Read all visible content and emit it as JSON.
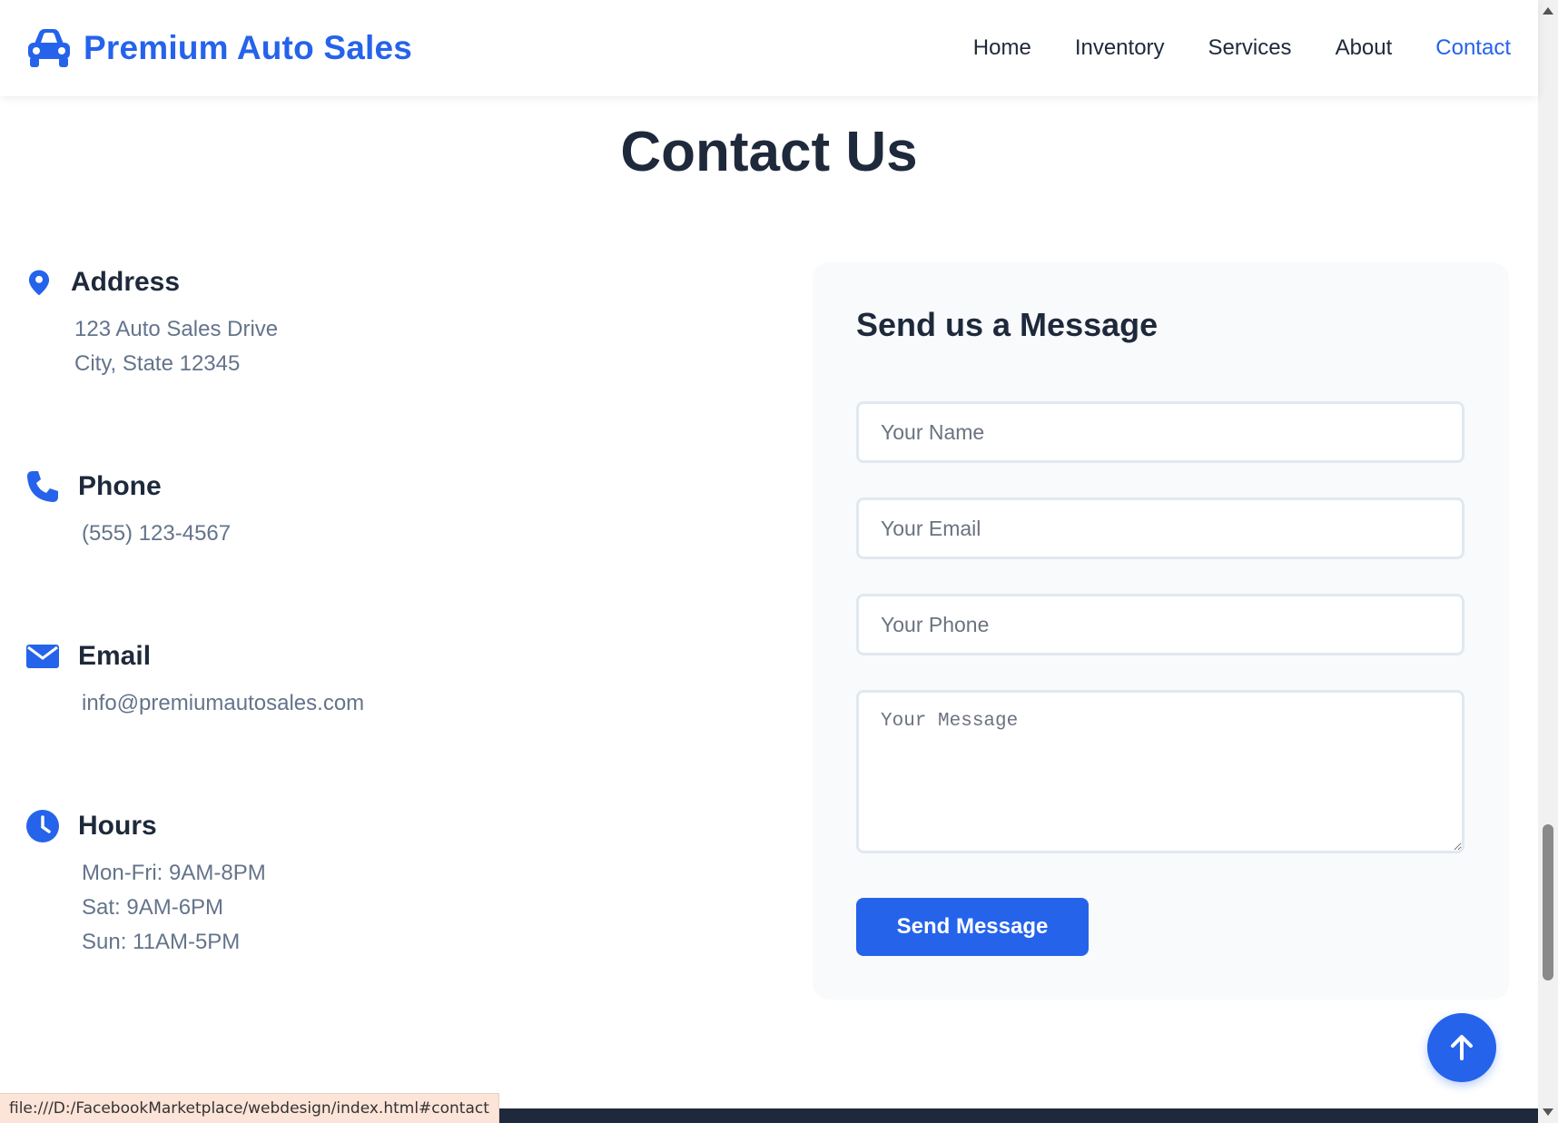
{
  "header": {
    "brand": "Premium Auto Sales",
    "brand_color": "#2563eb",
    "nav": [
      {
        "label": "Home",
        "active": false
      },
      {
        "label": "Inventory",
        "active": false
      },
      {
        "label": "Services",
        "active": false
      },
      {
        "label": "About",
        "active": false
      },
      {
        "label": "Contact",
        "active": true
      }
    ]
  },
  "page": {
    "title": "Contact Us"
  },
  "contact_info": {
    "address": {
      "title": "Address",
      "icon": "map-marker-icon",
      "lines": [
        "123 Auto Sales Drive",
        "City, State 12345"
      ]
    },
    "phone": {
      "title": "Phone",
      "icon": "phone-icon",
      "lines": [
        "(555) 123-4567"
      ]
    },
    "email": {
      "title": "Email",
      "icon": "envelope-icon",
      "lines": [
        "info@premiumautosales.com"
      ]
    },
    "hours": {
      "title": "Hours",
      "icon": "clock-icon",
      "lines": [
        "Mon-Fri: 9AM-8PM",
        "Sat: 9AM-6PM",
        "Sun: 11AM-5PM"
      ]
    }
  },
  "form": {
    "title": "Send us a Message",
    "name_placeholder": "Your Name",
    "email_placeholder": "Your Email",
    "phone_placeholder": "Your Phone",
    "message_placeholder": "Your Message",
    "submit_label": "Send Message"
  },
  "status_bar": {
    "url": "file:///D:/FacebookMarketplace/webdesign/index.html#contact"
  }
}
